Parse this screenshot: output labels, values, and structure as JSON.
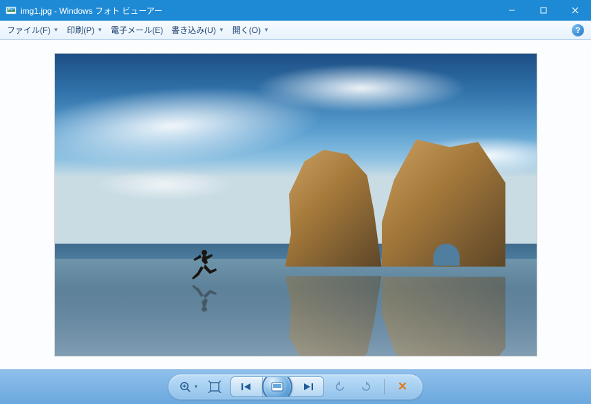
{
  "titlebar": {
    "title": "img1.jpg - Windows フォト ビューアー"
  },
  "menu": {
    "file": "ファイル(F)",
    "print": "印刷(P)",
    "email": "電子メール(E)",
    "burn": "書き込み(U)",
    "open": "開く(O)",
    "help_symbol": "?"
  },
  "toolbar": {
    "zoom": "zoom-icon",
    "fit": "fit-window-icon",
    "prev": "previous-icon",
    "play": "slideshow-icon",
    "next": "next-icon",
    "rotate_ccw": "rotate-ccw-icon",
    "rotate_cw": "rotate-cw-icon",
    "delete": "delete-icon"
  }
}
